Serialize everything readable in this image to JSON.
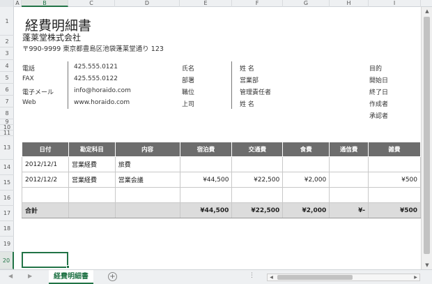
{
  "columns": [
    "A",
    "B",
    "C",
    "D",
    "E",
    "F",
    "G",
    "H",
    "I"
  ],
  "rows": [
    "1",
    "2",
    "3",
    "4",
    "5",
    "6",
    "7",
    "8",
    "9",
    "10",
    "11",
    "13",
    "14",
    "15",
    "16",
    "17",
    "18",
    "19",
    "20"
  ],
  "active_column": "B",
  "active_row": "20",
  "sheet": {
    "title": "経費明細書",
    "company": "蓬莱堂株式会社",
    "address": "〒990-9999 東京都豊島区池袋蓬莱堂通り 123"
  },
  "contact": {
    "labels": [
      "電話",
      "FAX",
      "電子メール",
      "Web"
    ],
    "values": [
      "425.555.0121",
      "425.555.0122",
      "info@horaido.com",
      "www.horaido.com"
    ]
  },
  "employee": {
    "labels": [
      "氏名",
      "部署",
      "職位",
      "上司"
    ],
    "values": [
      "姓 名",
      "営業部",
      "管理責任者",
      "姓 名"
    ]
  },
  "purpose": {
    "labels": [
      "目的",
      "開始日",
      "終了日",
      "作成者",
      "承認者"
    ]
  },
  "expense_table": {
    "headers": [
      "日付",
      "勘定科目",
      "内容",
      "宿泊費",
      "交通費",
      "食費",
      "通信費",
      "雑費"
    ],
    "rows": [
      [
        "2012/12/1",
        "営業経費",
        "旅費",
        "",
        "",
        "",
        "",
        ""
      ],
      [
        "2012/12/2",
        "営業経費",
        "営業会議",
        "¥44,500",
        "¥22,500",
        "¥2,000",
        "",
        "¥500"
      ],
      [
        "",
        "",
        "",
        "",
        "",
        "",
        "",
        ""
      ]
    ],
    "total": [
      "合計",
      "",
      "",
      "¥44,500",
      "¥22,500",
      "¥2,000",
      "¥-",
      "¥500"
    ]
  },
  "tabs": {
    "sheet_name": "経費明細書",
    "add_symbol": "+",
    "dots": "⋮"
  },
  "accent_color": "#217346",
  "header_fill": "#6d6d6d"
}
